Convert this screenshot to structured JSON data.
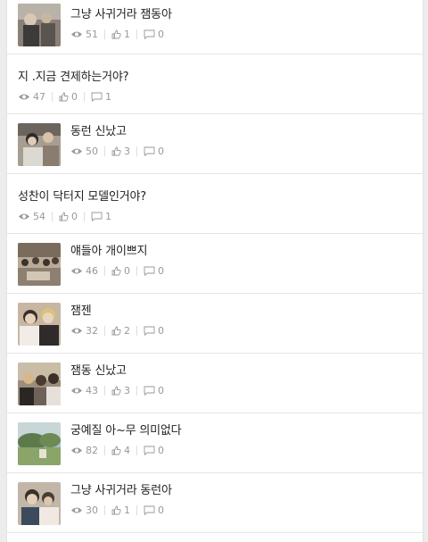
{
  "posts": [
    {
      "title": "그냥 사귀거라 잼동아",
      "views": "51",
      "likes": "1",
      "comments": "0",
      "thumb": "thumb-a"
    },
    {
      "title": "지 .지금 견제하는거야?",
      "views": "47",
      "likes": "0",
      "comments": "1",
      "thumb": null
    },
    {
      "title": "동런 신났고",
      "views": "50",
      "likes": "3",
      "comments": "0",
      "thumb": "thumb-b"
    },
    {
      "title": "성찬이 닥터지 모델인거야?",
      "views": "54",
      "likes": "0",
      "comments": "1",
      "thumb": null
    },
    {
      "title": "얘들아 개이쁘지",
      "views": "46",
      "likes": "0",
      "comments": "0",
      "thumb": "thumb-c"
    },
    {
      "title": "잼젠",
      "views": "32",
      "likes": "2",
      "comments": "0",
      "thumb": "thumb-d"
    },
    {
      "title": "잼동 신났고",
      "views": "43",
      "likes": "3",
      "comments": "0",
      "thumb": "thumb-e"
    },
    {
      "title": "궁예질 아~무 의미없다",
      "views": "82",
      "likes": "4",
      "comments": "0",
      "thumb": "thumb-f"
    },
    {
      "title": "그냥 사귀거라 동런아",
      "views": "30",
      "likes": "1",
      "comments": "0",
      "thumb": "thumb-g"
    }
  ],
  "icons": {
    "views": "eye-icon",
    "likes": "thumbs-up-icon",
    "comments": "comment-icon"
  },
  "colors": {
    "meta_text": "#999999",
    "title_text": "#222222",
    "divider": "#e5e5e5",
    "page_bg": "#ececec"
  }
}
